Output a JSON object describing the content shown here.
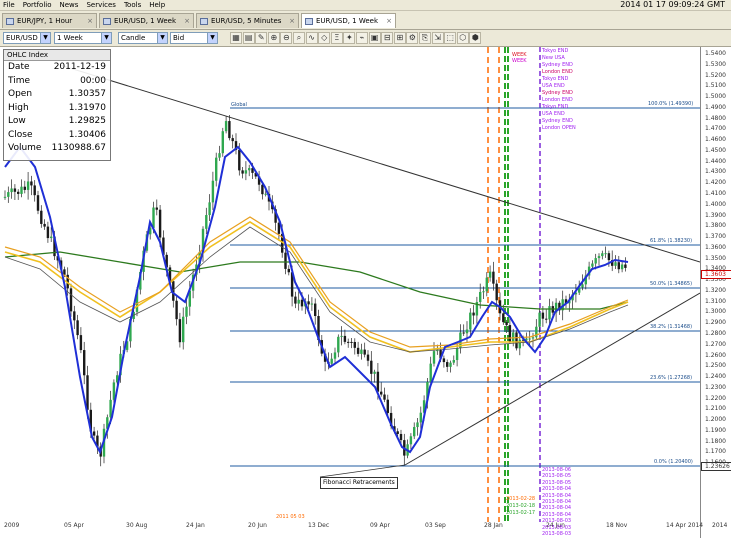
{
  "menu": [
    "File",
    "Portfolio",
    "News",
    "Services",
    "Tools",
    "Help"
  ],
  "clock": "2014 01 17 09:09:24 GMT",
  "tabs": [
    {
      "label": "EUR/JPY, 1 Hour"
    },
    {
      "label": "EUR/USD, 1 Week"
    },
    {
      "label": "EUR/USD, 5 Minutes"
    },
    {
      "label": "EUR/USD, 1 Week"
    }
  ],
  "toolbar": {
    "instrument": "EUR/USD",
    "period": "1 Week",
    "chart_type": "Candle",
    "side": "Bid"
  },
  "ohlc": {
    "header": "OHLC Index",
    "rows": [
      {
        "k": "Date",
        "v": "2011-12-19"
      },
      {
        "k": "Time",
        "v": "00:00"
      },
      {
        "k": "Open",
        "v": "1.30357"
      },
      {
        "k": "High",
        "v": "1.31970"
      },
      {
        "k": "Low",
        "v": "1.29825"
      },
      {
        "k": "Close",
        "v": "1.30406"
      },
      {
        "k": "Volume",
        "v": "1130988.67"
      }
    ]
  },
  "price_axis": [
    "1.5400",
    "1.5300",
    "1.5200",
    "1.5100",
    "1.5000",
    "1.4900",
    "1.4800",
    "1.4700",
    "1.4600",
    "1.4500",
    "1.4400",
    "1.4300",
    "1.4200",
    "1.4100",
    "1.4000",
    "1.3900",
    "1.3800",
    "1.3700",
    "1.3600",
    "1.3500",
    "1.3400",
    "1.3300",
    "1.3200",
    "1.3100",
    "1.3000",
    "1.2900",
    "1.2800",
    "1.2700",
    "1.2600",
    "1.2500",
    "1.2400",
    "1.2300",
    "1.2200",
    "1.2100",
    "1.2000",
    "1.1900",
    "1.1800",
    "1.1700",
    "1.1600"
  ],
  "current_price": "1.3603",
  "low_price_tag": "1.23626",
  "fib_levels": [
    {
      "label": "100.0% (1.49390)"
    },
    {
      "label": "61.8% (1.38230)"
    },
    {
      "label": "50.0% (1.34865)"
    },
    {
      "label": "38.2% (1.31468)"
    },
    {
      "label": "23.6% (1.27268)"
    },
    {
      "label": "0.0% (1.20400)"
    }
  ],
  "fib_point_label": "Global",
  "x_axis": [
    "2009",
    "05 Apr",
    "30 Aug",
    "24 Jan",
    "20 Jun",
    "13 Dec",
    "09 Apr",
    "03 Sep",
    "28 Jan",
    "24 Jun",
    "18 Nov",
    "14 Apr 2014",
    "2014"
  ],
  "callout": "Fibonacci Retracements",
  "events_top": [
    "WEEK",
    "WEEK",
    "Tokyo END",
    "New USA",
    "Sydney END",
    "London END",
    "Tokyo END",
    "USA END",
    "Sydney END",
    "London END",
    "Tokyo END",
    "USA END",
    "Sydney END",
    "London OPEN"
  ],
  "events_bottom": [
    "2013-08-06",
    "2013-08-05",
    "2013-08-05",
    "2013-08-04",
    "2013-08-04",
    "2013-08-04",
    "2013-08-04",
    "2013-08-04",
    "2013-08-03",
    "2013-08-03",
    "2013-08-03"
  ],
  "events_bottom_left": [
    "2013-02-28",
    "2013-02-18",
    "2013-02-17"
  ],
  "bottom_tag": "2011 05 03",
  "colors": {
    "blue_ma": "#1f2fd6",
    "green_ma": "#2d7a1e",
    "yellow_ma": "#f0c020",
    "orange_ma": "#e8a020",
    "fib": "#1f5ba0",
    "trend": "#333333",
    "orange_marker": "#ff6a00",
    "green_marker": "#2aa52a",
    "purple_marker": "#7a2ad6"
  }
}
